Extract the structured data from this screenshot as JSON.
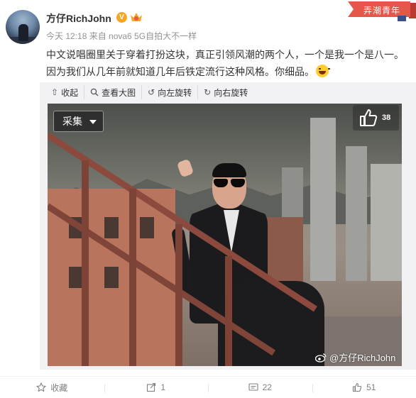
{
  "post": {
    "username": "方仔RichJohn",
    "meta": "今天 12:18 来自 nova6 5G自拍大不一样",
    "text": "中文说唱圈里关于穿着打扮这块，真正引领风潮的两个人，一个是我一个是八一。因为我们从几年前就知道几年后铁定流行这种风格。你细品。"
  },
  "tag": {
    "label": "弄潮青年"
  },
  "toolbar": {
    "collapse": "收起",
    "view_large": "查看大图",
    "rotate_left": "向左旋转",
    "rotate_right": "向右旋转"
  },
  "photo": {
    "collect_label": "采集",
    "like_count": "38",
    "watermark": "@方仔RichJohn"
  },
  "footer": {
    "favorite": "收藏",
    "repost": "1",
    "comment": "22",
    "like": "51"
  }
}
